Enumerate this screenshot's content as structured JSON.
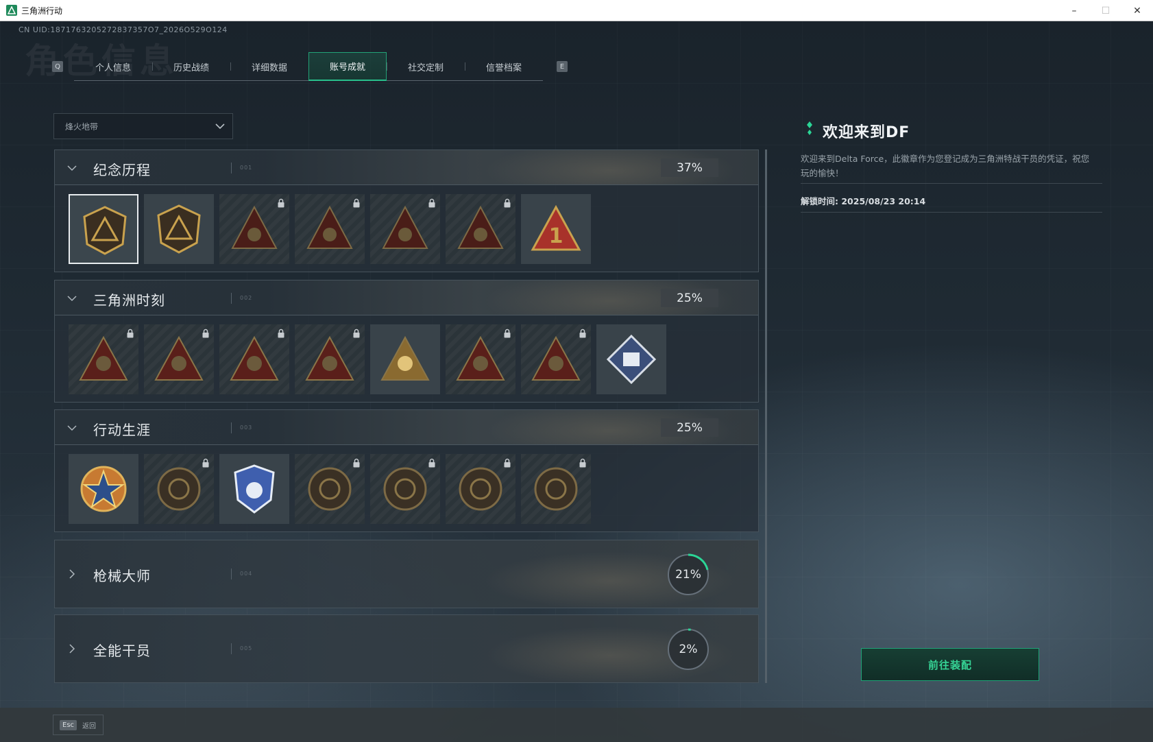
{
  "window": {
    "title": "三角洲行动"
  },
  "header": {
    "uid": "CN UID:1871763205272837357O7_2026O529O124",
    "ghost_title": "角色信息",
    "left_key": "Q",
    "right_key": "E"
  },
  "tabs": [
    {
      "label": "个人信息",
      "active": false
    },
    {
      "label": "历史战绩",
      "active": false
    },
    {
      "label": "详细数据",
      "active": false
    },
    {
      "label": "账号成就",
      "active": true
    },
    {
      "label": "社交定制",
      "active": false
    },
    {
      "label": "信誉档案",
      "active": false
    }
  ],
  "filter": {
    "value": "烽火地带"
  },
  "categories": [
    {
      "title": "纪念历程",
      "index": "001",
      "progress": "37%",
      "expanded": true
    },
    {
      "title": "三角洲时刻",
      "index": "002",
      "progress": "25%",
      "expanded": true
    },
    {
      "title": "行动生涯",
      "index": "003",
      "progress": "25%",
      "expanded": true
    },
    {
      "title": "枪械大师",
      "index": "004",
      "progress": "21%",
      "progress_value": 0.21,
      "expanded": false
    },
    {
      "title": "全能干员",
      "index": "005",
      "progress": "2%",
      "progress_value": 0.02,
      "expanded": false
    }
  ],
  "badges": {
    "memorial": [
      {
        "name": "badge-memorial-1",
        "locked": false,
        "selected": true
      },
      {
        "name": "badge-memorial-2",
        "locked": false
      },
      {
        "name": "badge-memorial-3",
        "locked": true
      },
      {
        "name": "badge-memorial-4",
        "locked": true
      },
      {
        "name": "badge-memorial-5",
        "locked": true
      },
      {
        "name": "badge-memorial-6",
        "locked": true
      },
      {
        "name": "badge-memorial-7",
        "locked": false,
        "label": "1"
      }
    ],
    "moments": [
      {
        "name": "badge-moment-1",
        "locked": true
      },
      {
        "name": "badge-moment-2",
        "locked": true
      },
      {
        "name": "badge-moment-3",
        "locked": true
      },
      {
        "name": "badge-moment-4",
        "locked": true
      },
      {
        "name": "badge-moment-5",
        "locked": false
      },
      {
        "name": "badge-moment-6",
        "locked": true
      },
      {
        "name": "badge-moment-7",
        "locked": true
      },
      {
        "name": "badge-moment-8",
        "locked": false
      }
    ],
    "career": [
      {
        "name": "badge-career-1",
        "locked": false
      },
      {
        "name": "badge-career-2",
        "locked": true
      },
      {
        "name": "badge-career-3",
        "locked": false
      },
      {
        "name": "badge-career-4",
        "locked": true
      },
      {
        "name": "badge-career-5",
        "locked": true
      },
      {
        "name": "badge-career-6",
        "locked": true
      },
      {
        "name": "badge-career-7",
        "locked": true
      }
    ]
  },
  "info": {
    "title": "欢迎来到DF",
    "description": "欢迎来到Delta Force，此徽章作为您登记成为三角洲特战干员的凭证，祝您玩的愉快！",
    "unlock_time": "解锁时间: 2025/08/23 20:14"
  },
  "actions": {
    "equip_label": "前往装配"
  },
  "footer": {
    "esc_key": "Esc",
    "esc_label": "返回"
  },
  "colors": {
    "accent": "#28c08c",
    "gold": "#c9a24e",
    "locked_red": "#5a1f1a",
    "bg": "#1f2a33"
  },
  "icons": [
    "app-icon",
    "chevron-down-icon",
    "chevron-right-icon",
    "lock-icon",
    "diamond-icon",
    "minimize-icon",
    "maximize-icon",
    "close-icon"
  ]
}
